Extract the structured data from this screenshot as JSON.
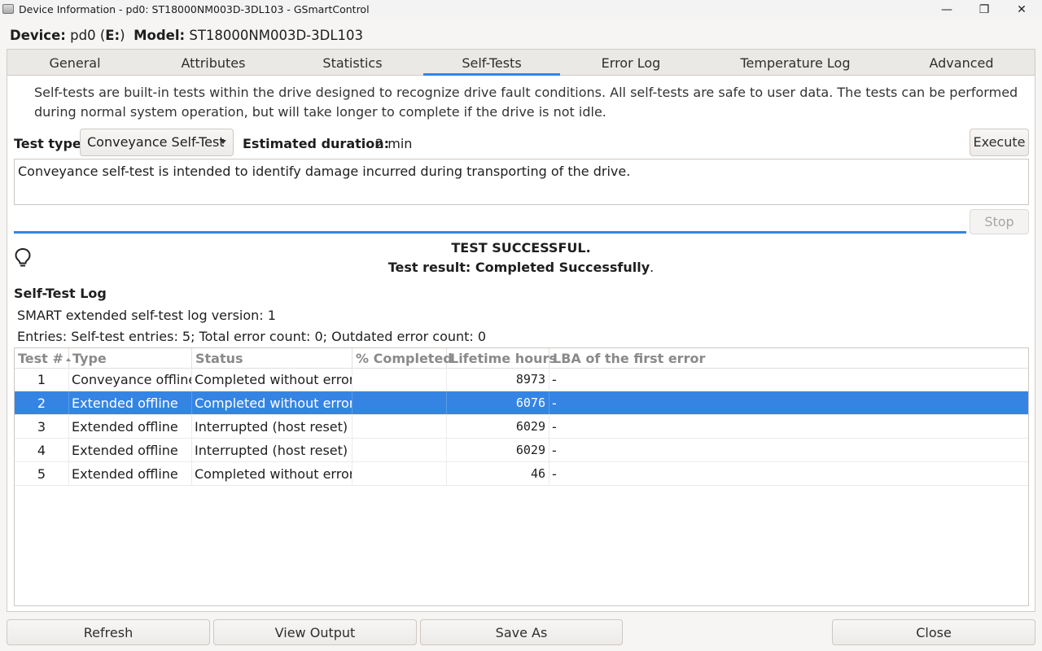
{
  "window": {
    "title": "Device Information - pd0: ST18000NM003D-3DL103 - GSmartControl",
    "min_icon": "minimize-icon",
    "max_icon": "maximize-icon",
    "close_icon": "close-icon",
    "min_glyph": "—",
    "max_glyph": "❐",
    "close_glyph": "✕"
  },
  "device": {
    "device_label": "Device:",
    "device_name": "pd0",
    "drive_open": "(",
    "drive_letter": "E:",
    "drive_close": ")",
    "model_label": "Model:",
    "model_value": "ST18000NM003D-3DL103"
  },
  "tabs": [
    "General",
    "Attributes",
    "Statistics",
    "Self-Tests",
    "Error Log",
    "Temperature Log",
    "Advanced"
  ],
  "active_tab": "Self-Tests",
  "selftests": {
    "description": "Self-tests are built-in tests within the drive designed to recognize drive fault conditions. All self-tests are safe to user data. The tests can be performed during normal system operation, but will take longer to complete if the drive is not idle.",
    "test_type_label": "Test type:",
    "test_type_value": "Conveyance Self-Test",
    "duration_label": "Estimated duration:",
    "duration_value": "2 min",
    "execute_label": "Execute",
    "test_description": "Conveyance self-test is intended to identify damage incurred during transporting of the drive.",
    "stop_label": "Stop",
    "progress_fraction": 1.0,
    "result_title": "TEST SUCCESSFUL.",
    "result_label": "Test result:",
    "result_value": "Completed Successfully",
    "result_suffix": ".",
    "result_icon": "lightbulb-icon"
  },
  "log": {
    "heading": "Self-Test Log",
    "version_text": "SMART extended self-test log version: 1",
    "entries_text": "Entries: Self-test entries: 5; Total error count: 0; Outdated error count: 0",
    "columns": [
      "Test #",
      "Type",
      "Status",
      "% Completed",
      "Lifetime hours",
      "LBA of the first error"
    ],
    "sort_column": "Test #",
    "sort_direction": "ascending",
    "selected_row": 2,
    "rows": [
      {
        "num": "1",
        "type": "Conveyance offline",
        "status": "Completed without error",
        "completed": "",
        "hours": "8973",
        "lba": "-"
      },
      {
        "num": "2",
        "type": "Extended offline",
        "status": "Completed without error",
        "completed": "",
        "hours": "6076",
        "lba": "-"
      },
      {
        "num": "3",
        "type": "Extended offline",
        "status": "Interrupted (host reset)",
        "completed": "",
        "hours": "6029",
        "lba": "-"
      },
      {
        "num": "4",
        "type": "Extended offline",
        "status": "Interrupted (host reset)",
        "completed": "",
        "hours": "6029",
        "lba": "-"
      },
      {
        "num": "5",
        "type": "Extended offline",
        "status": "Completed without error",
        "completed": "",
        "hours": "46",
        "lba": "-"
      }
    ]
  },
  "buttons": {
    "refresh": "Refresh",
    "view_output": "View Output",
    "save_as": "Save As",
    "close": "Close"
  },
  "colors": {
    "accent": "#3584e4",
    "window_bg": "#f6f5f4"
  }
}
